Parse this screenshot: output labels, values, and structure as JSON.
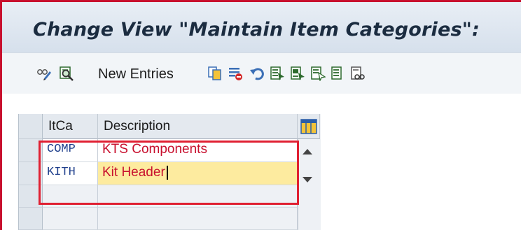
{
  "window": {
    "title": "Change View \"Maintain Item Categories\":"
  },
  "toolbar": {
    "new_entries_label": "New Entries",
    "icons": [
      "display-change-icon",
      "details-icon",
      "copy-icon",
      "delete-icon",
      "undo-icon",
      "select-all-icon",
      "select-block-icon",
      "deselect-all-icon",
      "first-entry-icon",
      "print-icon"
    ]
  },
  "table": {
    "columns": [
      "ItCa",
      "Description"
    ],
    "rows": [
      {
        "code": "COMP",
        "description": "KTS Components"
      },
      {
        "code": "KITH",
        "description": "Kit Header"
      }
    ]
  },
  "colors": {
    "frame": "#c8102e",
    "highlight": "#e02032",
    "editing": "#fdeb9f"
  }
}
